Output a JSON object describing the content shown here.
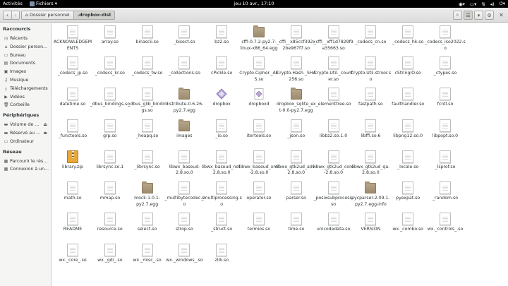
{
  "topbar": {
    "activities": "Activités",
    "app_menu": "Fichiers ▾",
    "clock": "jeu 10 avr., 17:10",
    "icons": [
      "accessibility-icon",
      "keyboard-layout-icon",
      "network-icon",
      "volume-icon",
      "power-icon"
    ]
  },
  "header": {
    "crumbs": [
      "Dossier personnel",
      ".dropbox-dist"
    ]
  },
  "sidebar": {
    "sections": [
      {
        "title": "Raccourcis",
        "items": [
          {
            "label": "Récents",
            "icon": "clock-icon"
          },
          {
            "label": "Dossier person...",
            "icon": "home-icon"
          },
          {
            "label": "Bureau",
            "icon": "desktop-icon"
          },
          {
            "label": "Documents",
            "icon": "documents-icon"
          },
          {
            "label": "Images",
            "icon": "images-icon"
          },
          {
            "label": "Musique",
            "icon": "music-icon"
          },
          {
            "label": "Téléchargements",
            "icon": "downloads-icon"
          },
          {
            "label": "Vidéos",
            "icon": "videos-icon"
          },
          {
            "label": "Corbeille",
            "icon": "trash-icon"
          }
        ]
      },
      {
        "title": "Périphériques",
        "items": [
          {
            "label": "Volume de ...",
            "icon": "drive-icon",
            "eject": true
          },
          {
            "label": "Réservé au ...",
            "icon": "drive-icon",
            "eject": true
          },
          {
            "label": "Ordinateur",
            "icon": "computer-icon"
          }
        ]
      },
      {
        "title": "Réseau",
        "items": [
          {
            "label": "Parcourir le rés...",
            "icon": "network-browse-icon"
          },
          {
            "label": "Connexion à un...",
            "icon": "connect-server-icon"
          }
        ]
      }
    ]
  },
  "files": [
    {
      "name": "ACKNOWLEDGEMENTS",
      "type": "doc"
    },
    {
      "name": "array.so",
      "type": "doc"
    },
    {
      "name": "binascii.so",
      "type": "doc"
    },
    {
      "name": "_bisect.so",
      "type": "doc"
    },
    {
      "name": "bz2.so",
      "type": "doc"
    },
    {
      "name": "cffi-0.7.2-py2.7-linux-x86_64.egg",
      "type": "folder"
    },
    {
      "name": "_cffi__x85ccf392x2be967f7.so",
      "type": "doc"
    },
    {
      "name": "_cffi__xff1d7829f9a35663.so",
      "type": "doc"
    },
    {
      "name": "_codecs_cn.so",
      "type": "doc"
    },
    {
      "name": "_codecs_hk.so",
      "type": "doc"
    },
    {
      "name": "_codecs_iso2022.so",
      "type": "doc"
    },
    {
      "name": "_codecs_jp.so",
      "type": "doc"
    },
    {
      "name": "_codecs_kr.so",
      "type": "doc"
    },
    {
      "name": "_codecs_tw.so",
      "type": "doc"
    },
    {
      "name": "_collections.so",
      "type": "doc"
    },
    {
      "name": "cPickle.so",
      "type": "doc"
    },
    {
      "name": "Crypto.Cipher._AES.so",
      "type": "doc"
    },
    {
      "name": "Crypto.Hash._SHA256.so",
      "type": "doc"
    },
    {
      "name": "Crypto.Util._counter.so",
      "type": "doc"
    },
    {
      "name": "Crypto.Util.strxor.so",
      "type": "doc"
    },
    {
      "name": "cStringIO.so",
      "type": "doc"
    },
    {
      "name": "_ctypes.so",
      "type": "doc"
    },
    {
      "name": "datetime.so",
      "type": "doc"
    },
    {
      "name": "_dbus_bindings.so",
      "type": "doc"
    },
    {
      "name": "_dbus_glib_bindings.so",
      "type": "doc"
    },
    {
      "name": "distribute-0.6.26-py2.7.egg",
      "type": "folder"
    },
    {
      "name": "dropbox",
      "type": "exec"
    },
    {
      "name": "dropboxd",
      "type": "exec2"
    },
    {
      "name": "dropbox_sqlite_ext-0.0-py2.7.egg",
      "type": "folder"
    },
    {
      "name": "_elementtree.so",
      "type": "doc"
    },
    {
      "name": "fastpath.so",
      "type": "doc"
    },
    {
      "name": "faulthandler.so",
      "type": "doc"
    },
    {
      "name": "fcntl.so",
      "type": "doc"
    },
    {
      "name": "_functools.so",
      "type": "doc"
    },
    {
      "name": "grp.so",
      "type": "doc"
    },
    {
      "name": "_heapq.so",
      "type": "doc"
    },
    {
      "name": "images",
      "type": "folder"
    },
    {
      "name": "_io.so",
      "type": "doc"
    },
    {
      "name": "itertools.so",
      "type": "doc"
    },
    {
      "name": "_json.so",
      "type": "doc"
    },
    {
      "name": "libbz2.so.1.0",
      "type": "doc"
    },
    {
      "name": "libffi.so.6",
      "type": "doc"
    },
    {
      "name": "libpng12.so.0",
      "type": "doc"
    },
    {
      "name": "libpopt.so.0",
      "type": "doc"
    },
    {
      "name": "library.zip",
      "type": "zip"
    },
    {
      "name": "librsync.so.1",
      "type": "doc"
    },
    {
      "name": "_librsync.so",
      "type": "doc"
    },
    {
      "name": "libwx_baseud-2.8.so.0",
      "type": "doc"
    },
    {
      "name": "libwx_baseud_net-2.8.so.0",
      "type": "doc"
    },
    {
      "name": "libwx_baseud_xml-2.8.so.0",
      "type": "doc"
    },
    {
      "name": "libwx_gtk2ud_adv-2.8.so.0",
      "type": "doc"
    },
    {
      "name": "libwx_gtk2ud_core-2.8.so.0",
      "type": "doc"
    },
    {
      "name": "libwx_gtk2ud_qa-2.8.so.0",
      "type": "doc"
    },
    {
      "name": "_locale.so",
      "type": "doc"
    },
    {
      "name": "_lsprof.so",
      "type": "doc"
    },
    {
      "name": "math.so",
      "type": "doc"
    },
    {
      "name": "mmap.so",
      "type": "doc"
    },
    {
      "name": "mock-1.0.1-py2.7.egg",
      "type": "folder"
    },
    {
      "name": "_multibytecodec.so",
      "type": "doc"
    },
    {
      "name": "_multiprocessing.so",
      "type": "doc"
    },
    {
      "name": "operator.so",
      "type": "doc"
    },
    {
      "name": "parser.so",
      "type": "doc"
    },
    {
      "name": "_posixsubprocess.so",
      "type": "doc"
    },
    {
      "name": "pycparser-2.09.1-py2.7.egg-info",
      "type": "folder"
    },
    {
      "name": "pyexpat.so",
      "type": "doc"
    },
    {
      "name": "_random.so",
      "type": "doc"
    },
    {
      "name": "README",
      "type": "doc"
    },
    {
      "name": "resource.so",
      "type": "doc"
    },
    {
      "name": "select.so",
      "type": "doc"
    },
    {
      "name": "strop.so",
      "type": "doc"
    },
    {
      "name": "_struct.so",
      "type": "doc"
    },
    {
      "name": "termios.so",
      "type": "doc"
    },
    {
      "name": "time.so",
      "type": "doc"
    },
    {
      "name": "unicodedata.so",
      "type": "doc"
    },
    {
      "name": "VERSION",
      "type": "doc"
    },
    {
      "name": "wx._combo.so",
      "type": "doc"
    },
    {
      "name": "wx._controls_.so",
      "type": "doc"
    },
    {
      "name": "wx._core_.so",
      "type": "doc"
    },
    {
      "name": "wx._gdi_.so",
      "type": "doc"
    },
    {
      "name": "wx._misc_.so",
      "type": "doc"
    },
    {
      "name": "wx._windows_.so",
      "type": "doc"
    },
    {
      "name": "zlib.so",
      "type": "doc"
    }
  ]
}
